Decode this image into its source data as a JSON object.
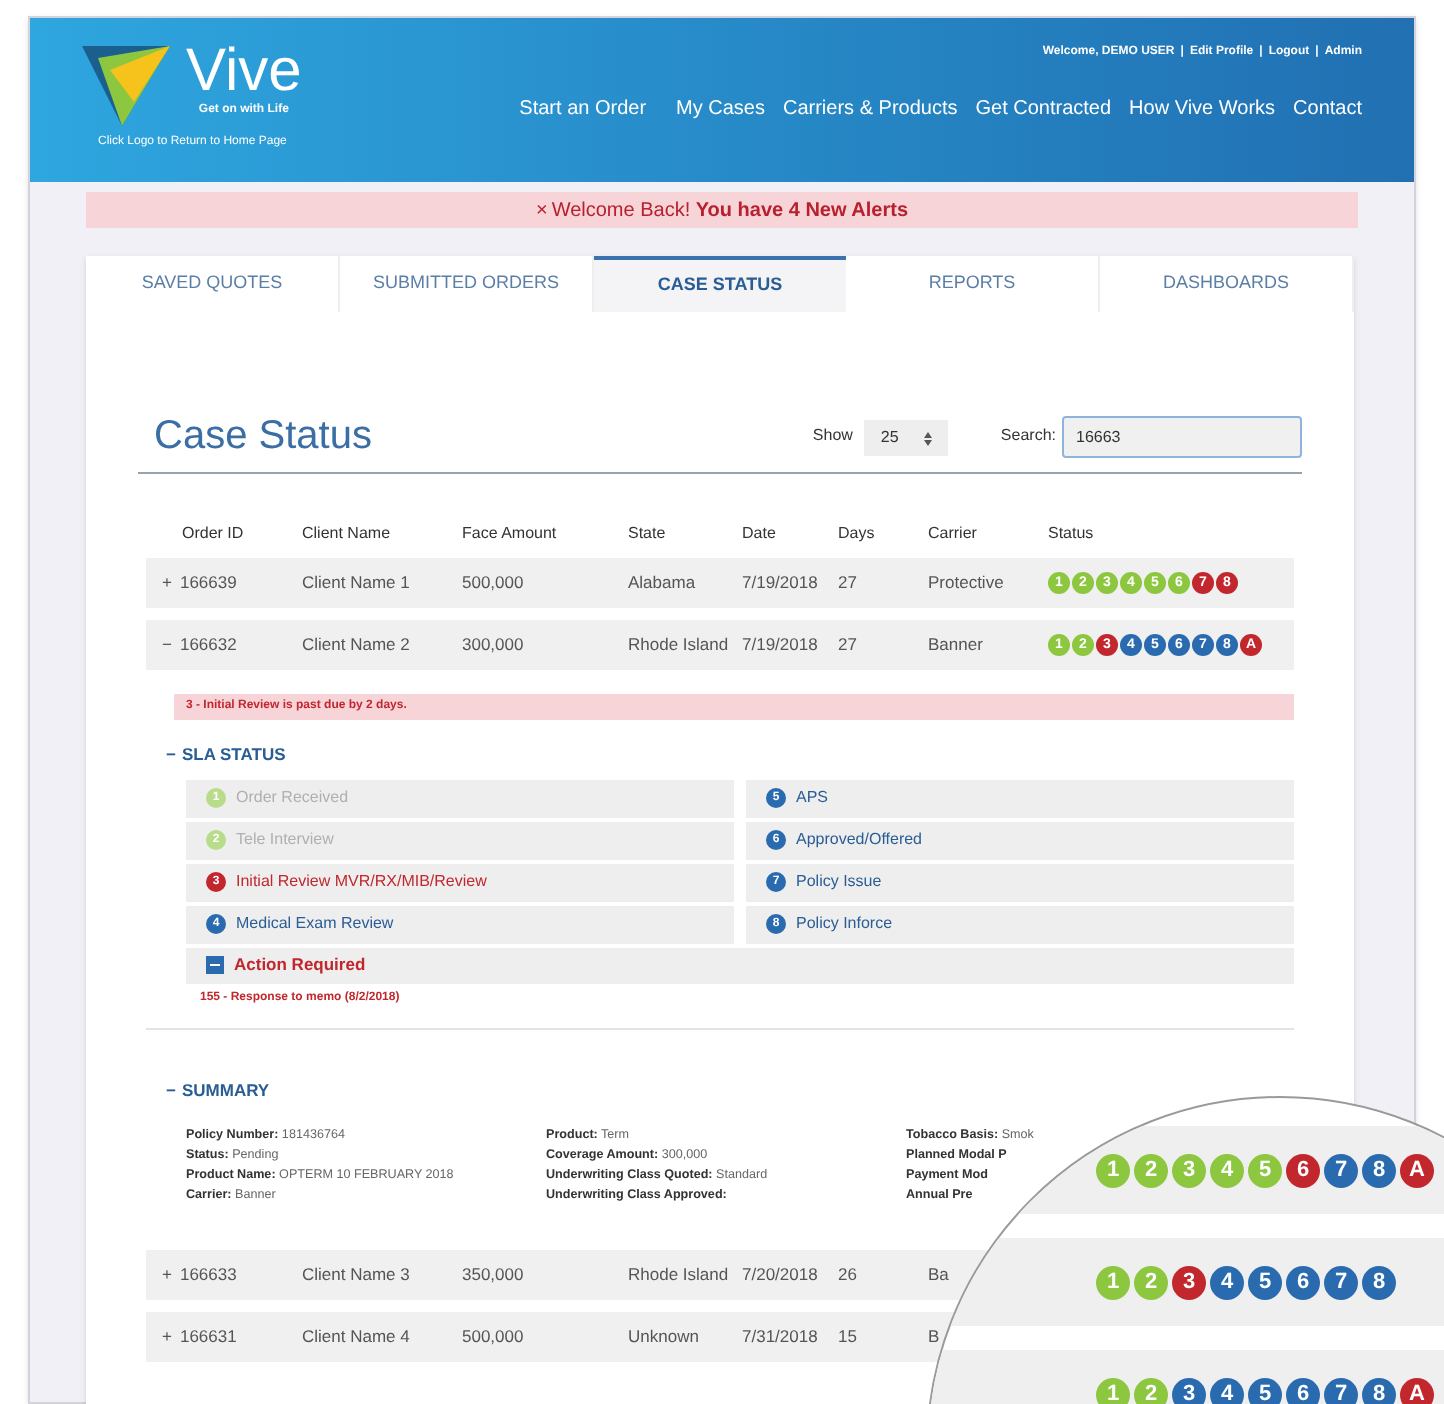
{
  "header": {
    "logo_text": "Vive",
    "tagline": "Get on with Life",
    "logo_hint": "Click Logo to Return to Home Page",
    "separator": "|",
    "user_links": [
      "Welcome, DEMO USER",
      "Edit Profile",
      "Logout",
      "Admin"
    ],
    "nav": [
      "Start an Order",
      "My Cases",
      "Carriers & Products",
      "Get Contracted",
      "How Vive Works",
      "Contact"
    ]
  },
  "alert": {
    "icon": "×",
    "text": "Welcome Back! **You have 4 New Alerts**"
  },
  "tabs": [
    {
      "label": "SAVED QUOTES",
      "selected": false
    },
    {
      "label": "SUBMITTED ORDERS",
      "selected": false
    },
    {
      "label": "CASE STATUS",
      "selected": true
    },
    {
      "label": "REPORTS",
      "selected": false
    },
    {
      "label": "DASHBOARDS",
      "selected": false
    }
  ],
  "case_status": {
    "title": "Case Status",
    "show_label": "Show",
    "page_size": "25",
    "search_label": "Search:",
    "search_value": "16663"
  },
  "table": {
    "columns": [
      "Order ID",
      "Client Name",
      "Face Amount",
      "State",
      "Date",
      "Days",
      "Carrier",
      "Status"
    ],
    "rows": [
      {
        "toggle": "+",
        "order_id": "166639",
        "client": "Client Name 1",
        "face": "500,000",
        "state": "Alabama",
        "date": "7/19/2018",
        "days": "27",
        "carrier": "Protective",
        "status": [
          {
            "label": "1",
            "color": "#8dc63f"
          },
          {
            "label": "2",
            "color": "#8dc63f"
          },
          {
            "label": "3",
            "color": "#8dc63f"
          },
          {
            "label": "4",
            "color": "#8dc63f"
          },
          {
            "label": "5",
            "color": "#8dc63f"
          },
          {
            "label": "6",
            "color": "#8dc63f"
          },
          {
            "label": "7",
            "color": "#c1272d"
          },
          {
            "label": "8",
            "color": "#c1272d"
          }
        ]
      },
      {
        "toggle": "−",
        "order_id": "166632",
        "client": "Client Name 2",
        "face": "300,000",
        "state": "Rhode Island",
        "date": "7/19/2018",
        "days": "27",
        "carrier": "Banner",
        "status": [
          {
            "label": "1",
            "color": "#8dc63f"
          },
          {
            "label": "2",
            "color": "#8dc63f"
          },
          {
            "label": "3",
            "color": "#c1272d"
          },
          {
            "label": "4",
            "color": "#2a6bb0"
          },
          {
            "label": "5",
            "color": "#2a6bb0"
          },
          {
            "label": "6",
            "color": "#2a6bb0"
          },
          {
            "label": "7",
            "color": "#2a6bb0"
          },
          {
            "label": "8",
            "color": "#2a6bb0"
          },
          {
            "label": "A",
            "color": "#c1272d"
          }
        ],
        "detail": {
          "notice": "3 - Initial Review is past due by 2 days.",
          "sla_toggle": "−",
          "sla_title": "SLA STATUS",
          "sla_items": [
            {
              "number": "1",
              "label": "Order Received",
              "kind": "done"
            },
            {
              "number": "5",
              "label": "APS",
              "kind": "pending"
            },
            {
              "number": "2",
              "label": "Tele Interview",
              "kind": "done"
            },
            {
              "number": "6",
              "label": "Approved/Offered",
              "kind": "pending"
            },
            {
              "number": "3",
              "label": "Initial Review MVR/RX/MIB/Review",
              "kind": "overdue"
            },
            {
              "number": "7",
              "label": "Policy Issue",
              "kind": "pending"
            },
            {
              "number": "4",
              "label": "Medical Exam Review",
              "kind": "pending"
            },
            {
              "number": "8",
              "label": "Policy Inforce",
              "kind": "pending"
            }
          ],
          "action": {
            "title": "Action Required",
            "memo": "155 - Response to memo (8/2/2018)"
          },
          "summary_toggle": "−",
          "summary_title": "SUMMARY",
          "summary_columns": [
            [
              {
                "label": "Policy Number:",
                "value": "181436764"
              },
              {
                "label": "Status:",
                "value": "Pending"
              },
              {
                "label": "Product Name:",
                "value": "OPTERM 10 FEBRUARY 2018"
              },
              {
                "label": "Carrier:",
                "value": "Banner"
              }
            ],
            [
              {
                "label": "Product:",
                "value": "Term"
              },
              {
                "label": "Coverage Amount:",
                "value": "300,000"
              },
              {
                "label": "Underwriting Class Quoted:",
                "value": "Standard"
              },
              {
                "label": "Underwriting Class Approved:"
              }
            ],
            [
              {
                "label": "Tobacco Basis:",
                "value": "Smok"
              },
              {
                "label": "Planned Modal P"
              },
              {
                "label": "Payment Mod"
              },
              {
                "label": "Annual Pre"
              }
            ]
          ]
        }
      },
      {
        "toggle": "+",
        "order_id": "166633",
        "client": "Client Name 3",
        "face": "350,000",
        "state": "Rhode Island",
        "date": "7/20/2018",
        "days": "26",
        "carrier": "Ba"
      },
      {
        "toggle": "+",
        "order_id": "166631",
        "client": "Client Name 4",
        "face": "500,000",
        "state": "Unknown",
        "date": "7/31/2018",
        "days": "15",
        "carrier": "B"
      }
    ]
  },
  "magnifier": {
    "rows": [
      [
        {
          "label": "1",
          "color": "#8dc63f"
        },
        {
          "label": "2",
          "color": "#8dc63f"
        },
        {
          "label": "3",
          "color": "#8dc63f"
        },
        {
          "label": "4",
          "color": "#8dc63f"
        },
        {
          "label": "5",
          "color": "#8dc63f"
        },
        {
          "label": "6",
          "color": "#c1272d"
        },
        {
          "label": "7",
          "color": "#2a6bb0"
        },
        {
          "label": "8",
          "color": "#2a6bb0"
        },
        {
          "label": "A",
          "color": "#c1272d"
        }
      ],
      [
        {
          "label": "1",
          "color": "#8dc63f"
        },
        {
          "label": "2",
          "color": "#8dc63f"
        },
        {
          "label": "3",
          "color": "#c1272d"
        },
        {
          "label": "4",
          "color": "#2a6bb0"
        },
        {
          "label": "5",
          "color": "#2a6bb0"
        },
        {
          "label": "6",
          "color": "#2a6bb0"
        },
        {
          "label": "7",
          "color": "#2a6bb0"
        },
        {
          "label": "8",
          "color": "#2a6bb0"
        }
      ],
      [
        {
          "label": "1",
          "color": "#8dc63f"
        },
        {
          "label": "2",
          "color": "#8dc63f"
        },
        {
          "label": "3",
          "color": "#2a6bb0"
        },
        {
          "label": "4",
          "color": "#2a6bb0"
        },
        {
          "label": "5",
          "color": "#2a6bb0"
        },
        {
          "label": "6",
          "color": "#2a6bb0"
        },
        {
          "label": "7",
          "color": "#2a6bb0"
        },
        {
          "label": "8",
          "color": "#2a6bb0"
        },
        {
          "label": "A",
          "color": "#c1272d"
        }
      ]
    ]
  }
}
